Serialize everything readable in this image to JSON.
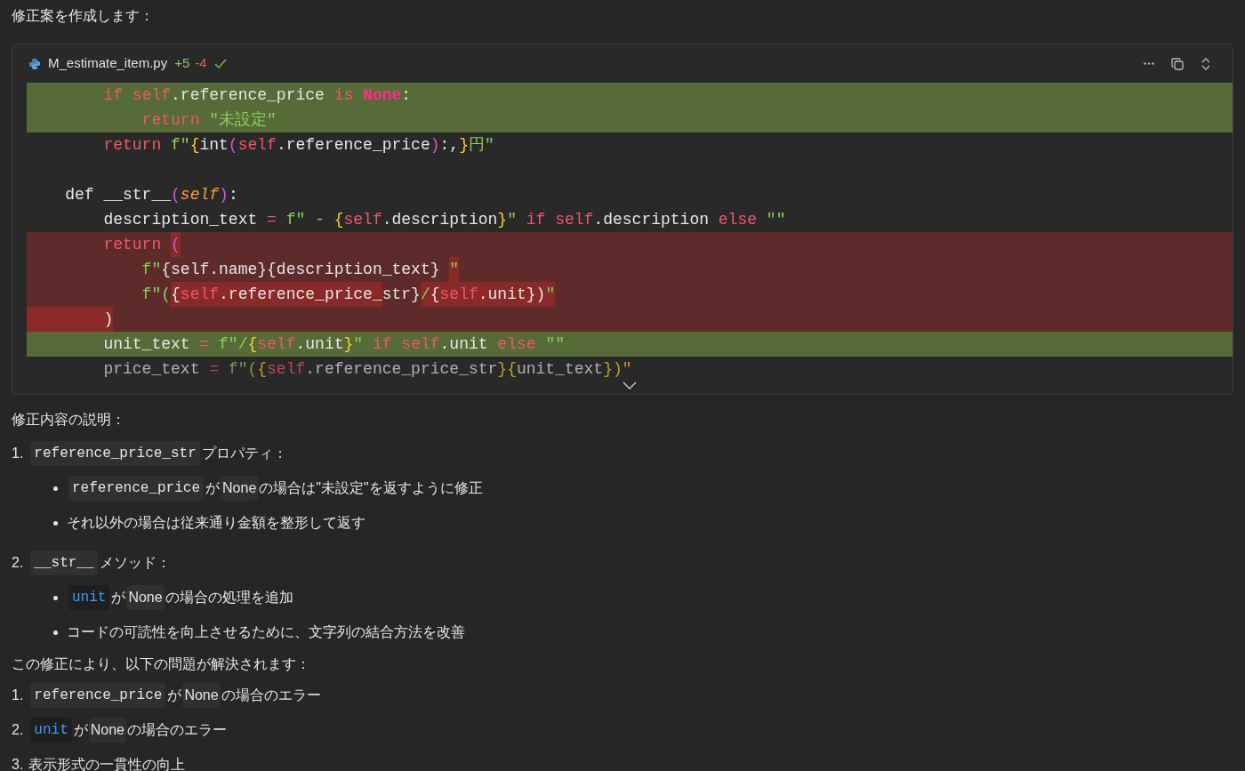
{
  "intro": "修正案を作成します：",
  "code_block": {
    "filename": "M_estimate_item.py",
    "added": "+5",
    "removed": "-4",
    "applied": true,
    "lines": [
      {
        "kind": "added",
        "tokens": [
          {
            "t": "        if ",
            "kind": "keyword"
          },
          {
            "t": "self",
            "kind": "self"
          },
          {
            "t": ".reference_price ",
            "kind": "plain"
          },
          {
            "t": "is ",
            "kind": "keyword"
          },
          {
            "t": "None",
            "kind": "constant"
          },
          {
            "t": ":",
            "kind": "plain"
          }
        ]
      },
      {
        "kind": "added",
        "tokens": [
          {
            "t": "            return ",
            "kind": "keyword"
          },
          {
            "t": "\"未設定\"",
            "kind": "string"
          }
        ]
      },
      {
        "kind": "context",
        "tokens": [
          {
            "t": "        return ",
            "kind": "keyword"
          },
          {
            "t": "f\"",
            "kind": "string"
          },
          {
            "t": "{",
            "kind": "brace"
          },
          {
            "t": "int",
            "kind": "plain"
          },
          {
            "t": "(",
            "kind": "paren"
          },
          {
            "t": "self",
            "kind": "self"
          },
          {
            "t": ".reference_price",
            "kind": "plain"
          },
          {
            "t": ")",
            "kind": "paren"
          },
          {
            "t": ":,",
            "kind": "plain"
          },
          {
            "t": "}",
            "kind": "brace"
          },
          {
            "t": "円\"",
            "kind": "string"
          }
        ]
      },
      {
        "kind": "context"
      },
      {
        "kind": "context",
        "tokens": [
          {
            "t": "    def __str__",
            "kind": "plain"
          },
          {
            "t": "(",
            "kind": "paren"
          },
          {
            "t": "self",
            "kind": "param"
          },
          {
            "t": ")",
            "kind": "paren"
          },
          {
            "t": ":",
            "kind": "plain"
          }
        ]
      },
      {
        "kind": "context",
        "tokens": [
          {
            "t": "        description_text ",
            "kind": "plain"
          },
          {
            "t": "= ",
            "kind": "keyword"
          },
          {
            "t": "f\" - ",
            "kind": "string"
          },
          {
            "t": "{",
            "kind": "brace"
          },
          {
            "t": "self",
            "kind": "self"
          },
          {
            "t": ".description",
            "kind": "plain"
          },
          {
            "t": "}",
            "kind": "brace"
          },
          {
            "t": "\" ",
            "kind": "string"
          },
          {
            "t": "if ",
            "kind": "keyword"
          },
          {
            "t": "self",
            "kind": "self"
          },
          {
            "t": ".description ",
            "kind": "plain"
          },
          {
            "t": "else ",
            "kind": "keyword"
          },
          {
            "t": "\"\"",
            "kind": "string"
          }
        ]
      },
      {
        "kind": "removed",
        "tokens": [
          {
            "t": "        return ",
            "kind": "keyword"
          },
          {
            "t": "(",
            "kind": "paren",
            "changed": true
          }
        ]
      },
      {
        "kind": "removed",
        "tokens": [
          {
            "t": "            f\"",
            "kind": "string"
          },
          {
            "t": "{self",
            "kind": "plain"
          },
          {
            "t": ".name}{description_text} ",
            "kind": "plain"
          },
          {
            "t": "\"",
            "kind": "string",
            "changed": true
          }
        ]
      },
      {
        "kind": "removed",
        "tokens": [
          {
            "t": "            f\"(",
            "kind": "string"
          },
          {
            "t": "{",
            "kind": "plain",
            "changed": true
          },
          {
            "t": "self",
            "kind": "self",
            "changed": true
          },
          {
            "t": ".reference_price_",
            "kind": "plain",
            "changed": true
          },
          {
            "t": "str}",
            "kind": "plain"
          },
          {
            "t": "/",
            "kind": "string",
            "changed": true
          },
          {
            "t": "{",
            "kind": "plain",
            "changed": true
          },
          {
            "t": "self",
            "kind": "self",
            "changed": true
          },
          {
            "t": ".unit})",
            "kind": "plain",
            "changed": true
          },
          {
            "t": "\"",
            "kind": "string",
            "changed": true
          }
        ]
      },
      {
        "kind": "removed",
        "tokens": [
          {
            "t": "        )",
            "kind": "plain",
            "changed": true
          }
        ]
      },
      {
        "kind": "added",
        "tokens": [
          {
            "t": "        unit_text ",
            "kind": "plain"
          },
          {
            "t": "= ",
            "kind": "keyword"
          },
          {
            "t": "f\"/",
            "kind": "string"
          },
          {
            "t": "{",
            "kind": "brace"
          },
          {
            "t": "self",
            "kind": "self"
          },
          {
            "t": ".unit",
            "kind": "plain"
          },
          {
            "t": "}",
            "kind": "brace"
          },
          {
            "t": "\" ",
            "kind": "string"
          },
          {
            "t": "if ",
            "kind": "keyword"
          },
          {
            "t": "self",
            "kind": "self"
          },
          {
            "t": ".unit ",
            "kind": "plain"
          },
          {
            "t": "else ",
            "kind": "keyword"
          },
          {
            "t": "\"\"",
            "kind": "string"
          }
        ]
      },
      {
        "kind": "faded",
        "tokens": [
          {
            "t": "        price_text ",
            "kind": "plain"
          },
          {
            "t": "= ",
            "kind": "keyword"
          },
          {
            "t": "f\"(",
            "kind": "string"
          },
          {
            "t": "{",
            "kind": "brace"
          },
          {
            "t": "self",
            "kind": "self"
          },
          {
            "t": ".reference_price_str",
            "kind": "plain"
          },
          {
            "t": "}{",
            "kind": "brace"
          },
          {
            "t": "unit_text",
            "kind": "plain"
          },
          {
            "t": "})\"",
            "kind": "brace"
          }
        ]
      }
    ]
  },
  "explanation_title": "修正内容の説明：",
  "sections": [
    {
      "number": "1.",
      "segments": [
        {
          "kind": "code",
          "t": "reference_price_str"
        },
        {
          "kind": "text",
          "t": "プロパティ："
        }
      ],
      "bullets": [
        [
          {
            "kind": "code",
            "t": "reference_price"
          },
          {
            "kind": "text",
            "t": "が"
          },
          {
            "kind": "pill",
            "t": "None"
          },
          {
            "kind": "text",
            "t": "の場合は\"未設定\"を返すように修正"
          }
        ],
        [
          {
            "kind": "text",
            "t": "それ以外の場合は従来通り金額を整形して返す"
          }
        ]
      ]
    },
    {
      "number": "2.",
      "segments": [
        {
          "kind": "code",
          "t": "__str__"
        },
        {
          "kind": "text",
          "t": "メソッド："
        }
      ],
      "bullets": [
        [
          {
            "kind": "symbol",
            "t": "unit"
          },
          {
            "kind": "text",
            "t": "が"
          },
          {
            "kind": "pill",
            "t": "None"
          },
          {
            "kind": "text",
            "t": "の場合の処理を追加"
          }
        ],
        [
          {
            "kind": "text",
            "t": "コードの可読性を向上させるために、文字列の結合方法を改善"
          }
        ]
      ]
    }
  ],
  "summary": "この修正により、以下の問題が解決されます：",
  "problems": [
    {
      "number": "1.",
      "segments": [
        {
          "kind": "code",
          "t": "reference_price"
        },
        {
          "kind": "text",
          "t": "が"
        },
        {
          "kind": "pill",
          "t": "None"
        },
        {
          "kind": "text",
          "t": "の場合のエラー"
        }
      ]
    },
    {
      "number": "2.",
      "segments": [
        {
          "kind": "symbol",
          "t": "unit"
        },
        {
          "kind": "text",
          "t": "が"
        },
        {
          "kind": "pill",
          "t": "None"
        },
        {
          "kind": "text",
          "t": "の場合のエラー"
        }
      ]
    },
    {
      "number": "3.",
      "segments": [
        {
          "kind": "text",
          "t": "表示形式の一貫性の向上"
        }
      ]
    }
  ]
}
